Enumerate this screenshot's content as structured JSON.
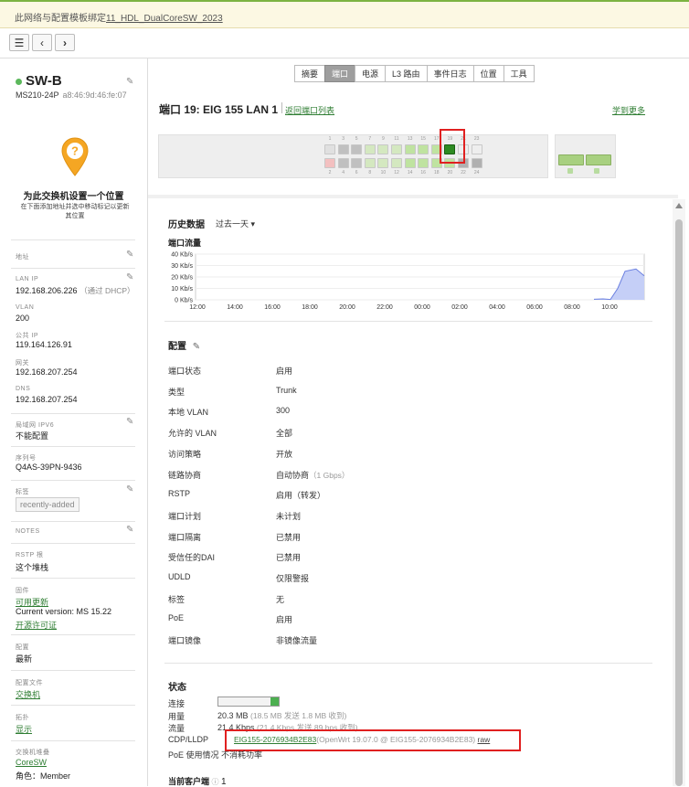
{
  "banner": {
    "prefix": "此网络与配置模板绑定",
    "link": "11_HDL_DualCoreSW_2023"
  },
  "nav": {
    "list_icon": "list-icon",
    "back_icon": "chevron-left-icon",
    "fwd_icon": "chevron-right-icon"
  },
  "device": {
    "name": "SW-B",
    "model": "MS210-24P",
    "mac": "a8:46:9d:46:fe:07",
    "location_title": "为此交换机设置一个位置",
    "location_sub": "在下面添加地址并选中移动标记以更新其位置",
    "address_label": "地址",
    "lanip_label": "LAN IP",
    "lanip": "192.168.206.226",
    "lanip_note": "（通过 DHCP）",
    "vlan_label": "VLAN",
    "vlan": "200",
    "publicip_label": "公共 IP",
    "publicip": "119.164.126.91",
    "gateway_label": "网关",
    "gateway": "192.168.207.254",
    "dns_label": "DNS",
    "dns": "192.168.207.254",
    "ipv6_label": "局域网 IPV6",
    "ipv6": "不能配置",
    "serial_label": "序列号",
    "serial": "Q4AS-39PN-9436",
    "tags_label": "标签",
    "tag": "recently-added",
    "notes_label": "NOTES",
    "rstp_label": "RSTP 根",
    "rstp": "这个堆栈",
    "fw_label": "固件",
    "fw_update": "可用更新",
    "fw_version": "Current version: MS 15.22",
    "fw_license": "开源许可证",
    "config_label": "配置",
    "config": "最新",
    "profile_label": "配置文件",
    "profile": "交换机",
    "topo_label": "拓扑",
    "topo": "显示",
    "stack_label": "交换机堆叠",
    "stack": "CoreSW",
    "role": "角色：Member"
  },
  "tabs": [
    "摘要",
    "端口",
    "电源",
    "L3 路由",
    "事件日志",
    "位置",
    "工具"
  ],
  "active_tab": 1,
  "port": {
    "title": "端口 19: EIG 155 LAN 1",
    "back": "返回端口列表",
    "learn": "学到更多",
    "selected": "19"
  },
  "history": {
    "title": "历史数据",
    "range": "过去一天 ▾"
  },
  "chart_data": {
    "type": "area",
    "title": "端口流量",
    "x": [
      "12:00",
      "14:00",
      "16:00",
      "18:00",
      "20:00",
      "22:00",
      "00:00",
      "02:00",
      "04:00",
      "06:00",
      "08:00",
      "10:00"
    ],
    "y_ticks": [
      "40 Kb/s",
      "30 Kb/s",
      "20 Kb/s",
      "10 Kb/s",
      "0 Kb/s"
    ],
    "ylim": [
      0,
      40
    ],
    "series": [
      {
        "values_tail": [
          0.5,
          0.8,
          0.3,
          10,
          25,
          27,
          21
        ]
      }
    ]
  },
  "config": {
    "title": "配置",
    "rows": [
      {
        "k": "端口状态",
        "v": "启用",
        "n": ""
      },
      {
        "k": "类型",
        "v": "Trunk",
        "n": ""
      },
      {
        "k": "本地 VLAN",
        "v": "300",
        "n": ""
      },
      {
        "k": "允许的 VLAN",
        "v": "全部",
        "n": ""
      },
      {
        "k": "访问策略",
        "v": "开放",
        "n": ""
      },
      {
        "k": "链路协商",
        "v": "自动协商",
        "n": "（1 Gbps）"
      },
      {
        "k": "RSTP",
        "v": "启用（转发）",
        "n": ""
      },
      {
        "k": "端口计划",
        "v": "未计划",
        "n": ""
      },
      {
        "k": "端口隔离",
        "v": "已禁用",
        "n": ""
      },
      {
        "k": "受信任的DAI",
        "v": "已禁用",
        "n": ""
      },
      {
        "k": "UDLD",
        "v": "仅限警报",
        "n": ""
      },
      {
        "k": "标签",
        "v": "无",
        "n": ""
      },
      {
        "k": "PoE",
        "v": "启用",
        "n": ""
      },
      {
        "k": "端口镜像",
        "v": "非镜像流量",
        "n": ""
      }
    ]
  },
  "status": {
    "title": "状态",
    "link_label": "连接",
    "usage_label": "用量",
    "usage": "20.3 MB",
    "usage_note": "(18.5 MB 发送 1.8 MB 收到)",
    "traffic_label": "流量",
    "traffic": "21.4 Kbps",
    "traffic_note": "(21.4 Kbps 发送 89 bps 收到)",
    "cdp_label": "CDP/LLDP",
    "cdp_link": "EIG155-2076934B2E83",
    "cdp_note": "(OpenWrt 19.07.0 @ EIG155-2076934B2E83)",
    "cdp_raw": "raw",
    "poe": "PoE 使用情况 不消耗功率",
    "clients_label": "当前客户端",
    "clients": "1"
  }
}
